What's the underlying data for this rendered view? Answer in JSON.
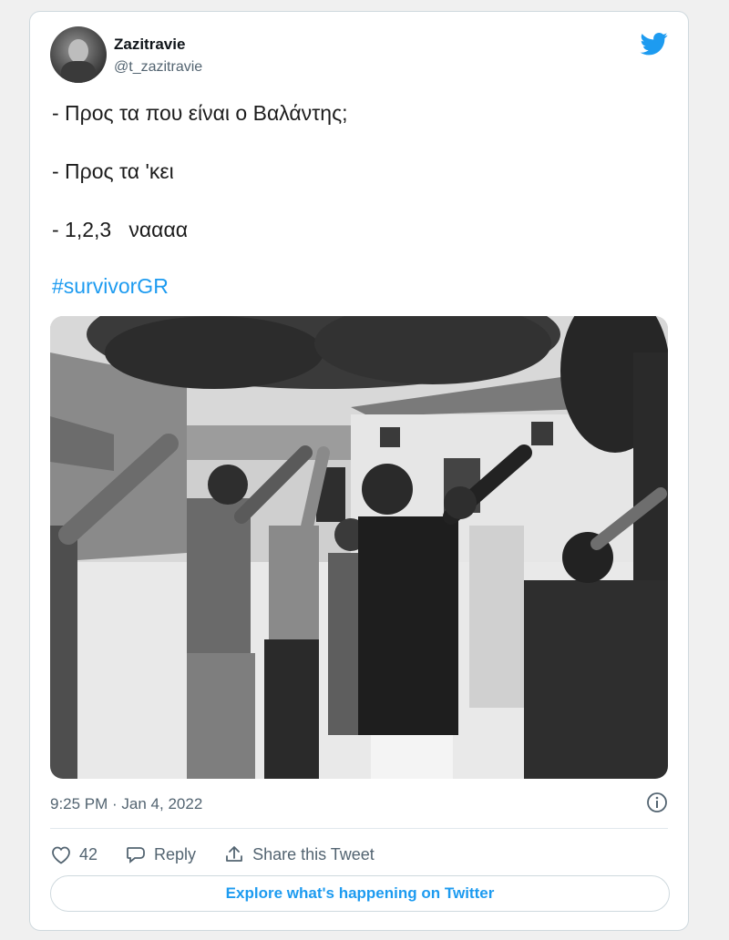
{
  "author": {
    "display_name": "Zazitravie",
    "handle": "@t_zazitravie"
  },
  "tweet": {
    "lines": [
      "- Προς τα που είναι ο Βαλάντης;",
      "- Προς τα 'κει",
      "- 1,2,3   ναααα"
    ],
    "hashtag": "#survivorGR"
  },
  "meta": {
    "timestamp": "9:25 PM · Jan 4, 2022"
  },
  "actions": {
    "like_count": "42",
    "reply_label": "Reply",
    "share_label": "Share this Tweet"
  },
  "footer": {
    "explore_label": "Explore what's happening on Twitter"
  },
  "icons": {
    "logo": "twitter-bird-icon",
    "info": "info-icon",
    "like": "heart-icon",
    "reply": "speech-bubble-icon",
    "share": "share-upload-icon"
  },
  "colors": {
    "accent": "#1d9bf0",
    "text_primary": "#0f1419",
    "text_secondary": "#536471",
    "border": "#cfd9de"
  }
}
